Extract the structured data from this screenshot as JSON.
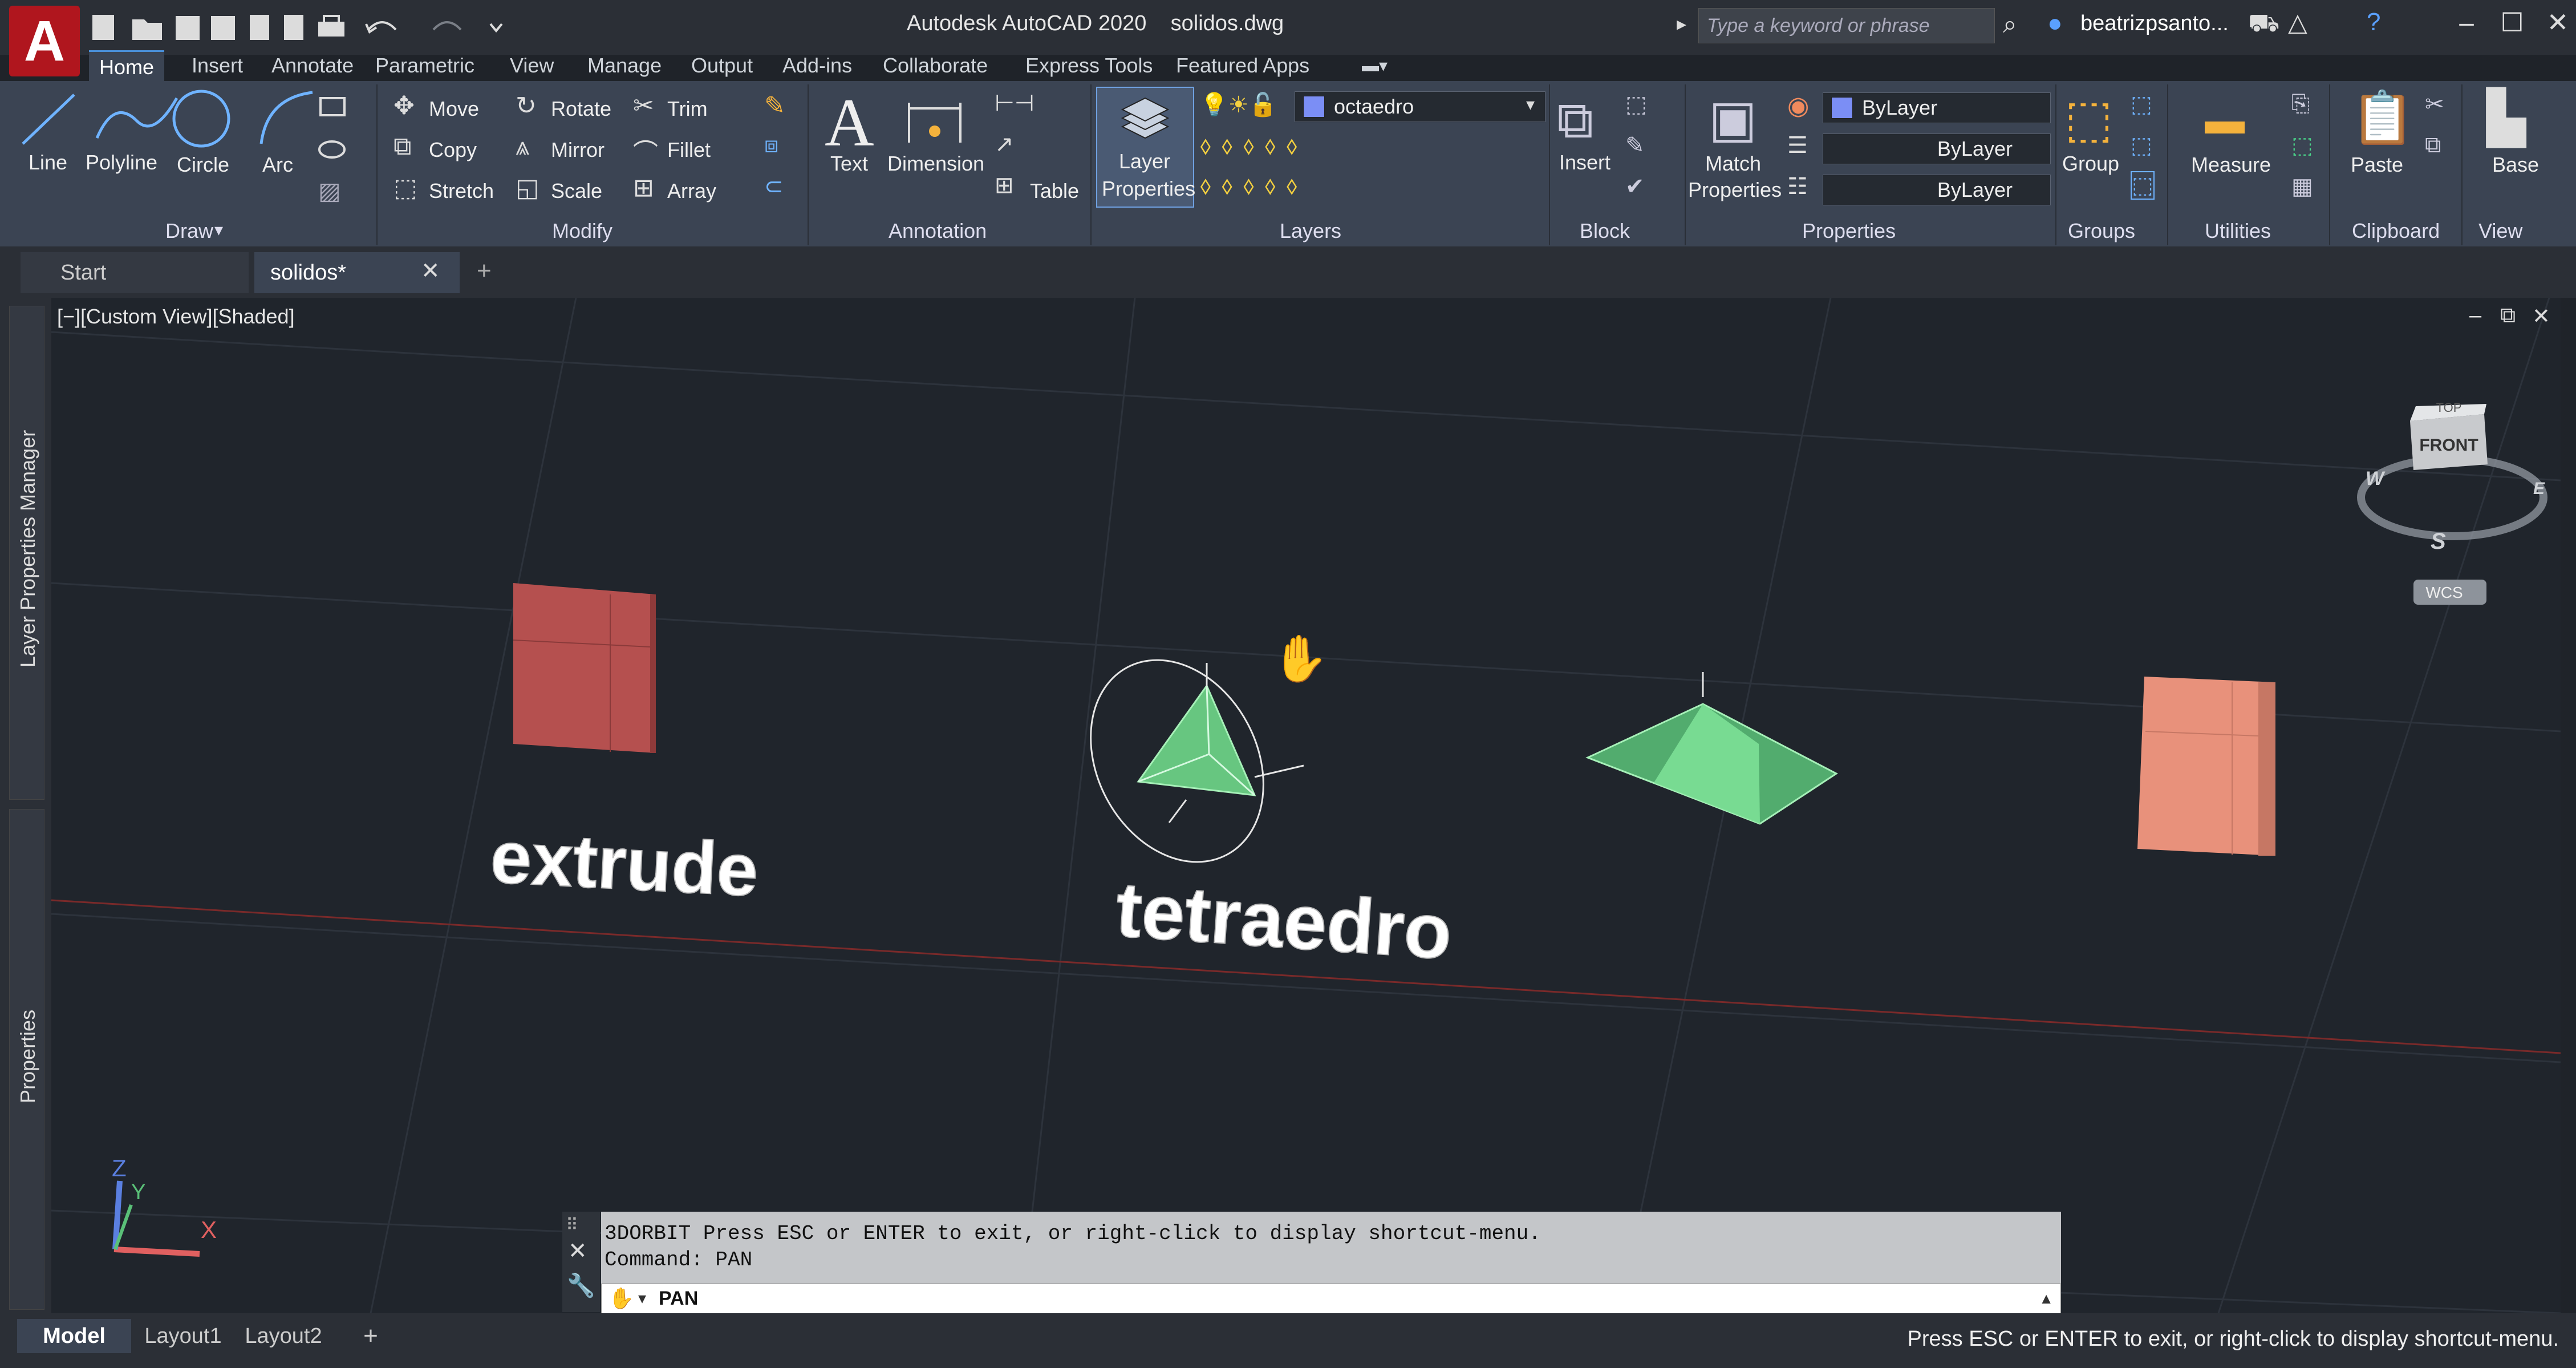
{
  "window": {
    "title": "Autodesk AutoCAD 2020    solidos.dwg",
    "app_letter": "A",
    "search_placeholder": "Type a keyword or phrase",
    "user": "beatrizpsanto..."
  },
  "ribbon_tabs": [
    "Home",
    "Insert",
    "Annotate",
    "Parametric",
    "View",
    "Manage",
    "Output",
    "Add-ins",
    "Collaborate",
    "Express Tools",
    "Featured Apps"
  ],
  "ribbon": {
    "draw": {
      "title": "Draw",
      "line": "Line",
      "polyline": "Polyline",
      "circle": "Circle",
      "arc": "Arc"
    },
    "modify": {
      "title": "Modify",
      "move": "Move",
      "rotate": "Rotate",
      "trim": "Trim",
      "copy": "Copy",
      "mirror": "Mirror",
      "fillet": "Fillet",
      "stretch": "Stretch",
      "scale": "Scale",
      "array": "Array"
    },
    "annotation": {
      "title": "Annotation",
      "text": "Text",
      "dimension": "Dimension",
      "table": "Table"
    },
    "layers": {
      "title": "Layers",
      "layer_properties_1": "Layer",
      "layer_properties_2": "Properties",
      "current_layer": "octaedro"
    },
    "block": {
      "title": "Block",
      "insert": "Insert"
    },
    "properties": {
      "title": "Properties",
      "match_1": "Match",
      "match_2": "Properties",
      "color": "ByLayer",
      "linetype": "ByLayer",
      "lineweight": "ByLayer"
    },
    "groups": {
      "title": "Groups",
      "group": "Group"
    },
    "utilities": {
      "title": "Utilities",
      "measure": "Measure"
    },
    "clipboard": {
      "title": "Clipboard",
      "paste": "Paste"
    },
    "view": {
      "title": "View",
      "base": "Base"
    }
  },
  "doc_tabs": {
    "start": "Start",
    "current": "solidos*"
  },
  "side_palettes": {
    "layer_manager": "Layer Properties Manager",
    "properties": "Properties"
  },
  "viewport": {
    "label": "[−][Custom View][Shaded]",
    "texts": {
      "extrude": "extrude",
      "tetraedro": "tetraedro"
    },
    "viewcube": {
      "top": "TOP",
      "front": "FRONT",
      "w": "W",
      "e": "E",
      "s": "S",
      "wcs": "WCS"
    },
    "ucs": {
      "x": "X",
      "y": "Y",
      "z": "Z"
    }
  },
  "command": {
    "line1": "3DORBIT Press ESC or ENTER to exit, or right-click to display shortcut-menu.",
    "line2": "Command: PAN",
    "input": "PAN"
  },
  "layout_tabs": [
    "Model",
    "Layout1",
    "Layout2"
  ],
  "status_text": "Press ESC or ENTER to exit, or right-click to display shortcut-menu.",
  "colors": {
    "ribbon": "#3b4453",
    "viewport": "#20252c",
    "solid_green": "#6fd88a",
    "box_red": "#b5504f",
    "box_orange": "#e8917b",
    "accent": "#4a90d9"
  }
}
